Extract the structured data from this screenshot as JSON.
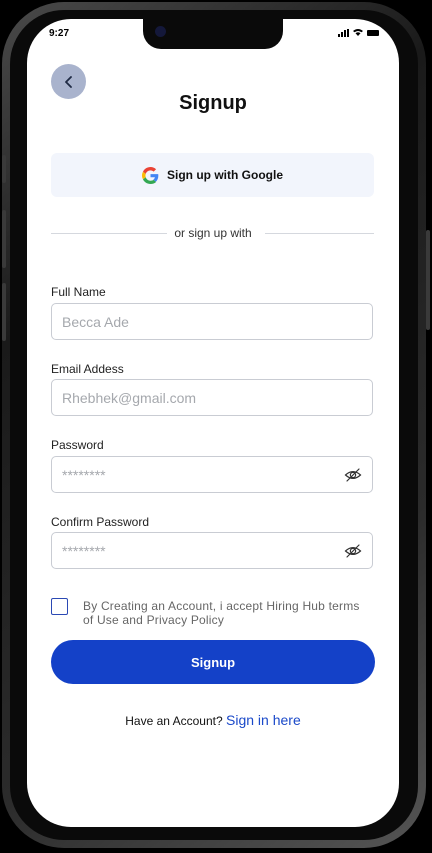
{
  "status": {
    "time": "9:27"
  },
  "header": {
    "title": "Signup"
  },
  "google": {
    "label": "Sign up with Google"
  },
  "divider": {
    "text": "or sign up with"
  },
  "form": {
    "full_name": {
      "label": "Full Name",
      "placeholder": "Becca Ade"
    },
    "email": {
      "label": "Email Addess",
      "placeholder": "Rhebhek@gmail.com"
    },
    "password": {
      "label": "Password",
      "placeholder": "********"
    },
    "confirm": {
      "label": "Confirm Password",
      "placeholder": "********"
    }
  },
  "terms": {
    "text": "By Creating an Account, i accept Hiring Hub terms of Use and Privacy Policy",
    "checked": false
  },
  "submit": {
    "label": "Signup"
  },
  "footer": {
    "prompt": "Have an Account?",
    "link": "Sign in here"
  },
  "colors": {
    "primary": "#1441c8",
    "back_button": "#a9b3cd",
    "google_bg": "#f2f5fc",
    "link": "#1a49c9"
  },
  "icons": {
    "back": "chevron-left-icon",
    "google": "google-icon",
    "eye": "eye-off-icon"
  }
}
